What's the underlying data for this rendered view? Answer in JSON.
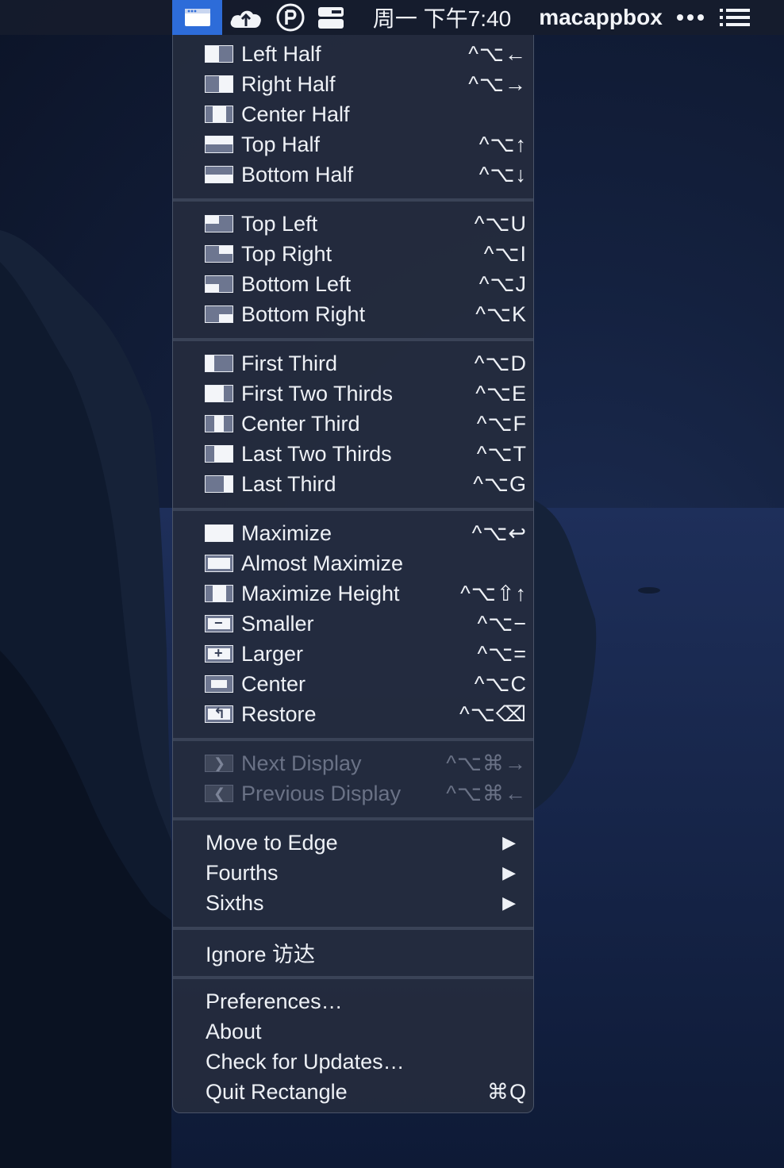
{
  "menubar": {
    "clock": "周一 下午7:40",
    "username": "macappbox",
    "icons": [
      "rectangle-app-icon",
      "cloud-icon",
      "p-shield-icon",
      "hardware-icon",
      "more-dots-icon",
      "list-menu-icon"
    ]
  },
  "menu": {
    "halves": [
      {
        "label": "Left Half",
        "shortcut": "^⌥←"
      },
      {
        "label": "Right Half",
        "shortcut": "^⌥→"
      },
      {
        "label": "Center Half",
        "shortcut": ""
      },
      {
        "label": "Top Half",
        "shortcut": "^⌥↑"
      },
      {
        "label": "Bottom Half",
        "shortcut": "^⌥↓"
      }
    ],
    "corners": [
      {
        "label": "Top Left",
        "shortcut": "^⌥U"
      },
      {
        "label": "Top Right",
        "shortcut": "^⌥I"
      },
      {
        "label": "Bottom Left",
        "shortcut": "^⌥J"
      },
      {
        "label": "Bottom Right",
        "shortcut": "^⌥K"
      }
    ],
    "thirds": [
      {
        "label": "First Third",
        "shortcut": "^⌥D"
      },
      {
        "label": "First Two Thirds",
        "shortcut": "^⌥E"
      },
      {
        "label": "Center Third",
        "shortcut": "^⌥F"
      },
      {
        "label": "Last Two Thirds",
        "shortcut": "^⌥T"
      },
      {
        "label": "Last Third",
        "shortcut": "^⌥G"
      }
    ],
    "sizing": [
      {
        "label": "Maximize",
        "shortcut": "^⌥↩"
      },
      {
        "label": "Almost Maximize",
        "shortcut": ""
      },
      {
        "label": "Maximize Height",
        "shortcut": "^⌥⇧↑"
      },
      {
        "label": "Smaller",
        "shortcut": "^⌥−"
      },
      {
        "label": "Larger",
        "shortcut": "^⌥="
      },
      {
        "label": "Center",
        "shortcut": "^⌥C"
      },
      {
        "label": "Restore",
        "shortcut": "^⌥⌫"
      }
    ],
    "display": [
      {
        "label": "Next Display",
        "shortcut": "^⌥⌘→"
      },
      {
        "label": "Previous Display",
        "shortcut": "^⌥⌘←"
      }
    ],
    "submenus": [
      {
        "label": "Move to Edge",
        "arrow": "▶"
      },
      {
        "label": "Fourths",
        "arrow": "▶"
      },
      {
        "label": "Sixths",
        "arrow": "▶"
      }
    ],
    "ignore": {
      "label": "Ignore 访达"
    },
    "app": [
      {
        "label": "Preferences…",
        "shortcut": ""
      },
      {
        "label": "About",
        "shortcut": ""
      },
      {
        "label": "Check for Updates…",
        "shortcut": ""
      },
      {
        "label": "Quit Rectangle",
        "shortcut": "⌘Q"
      }
    ]
  }
}
